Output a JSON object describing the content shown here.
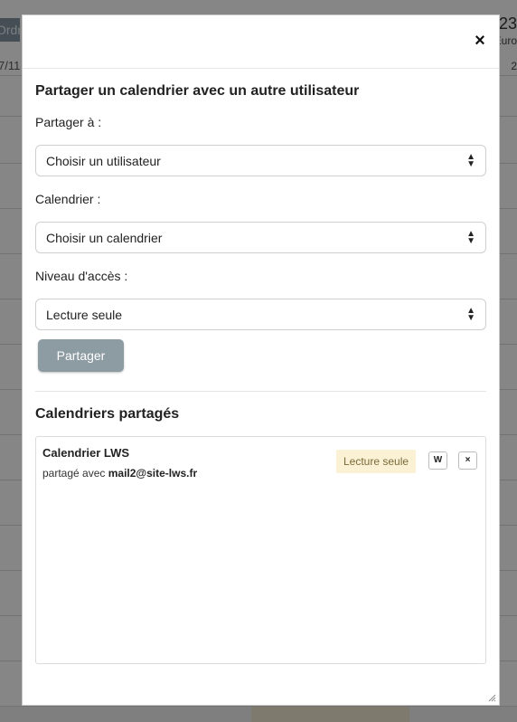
{
  "background": {
    "tab_text": "Ordr",
    "left_date": "7/11",
    "right_top": "23",
    "right_sub": "Euro",
    "right_date": "2"
  },
  "modal": {
    "close_icon": "×",
    "title": "Partager un calendrier avec un autre utilisateur",
    "share_to_label": "Partager à :",
    "share_to_value": "Choisir un utilisateur",
    "calendar_label": "Calendrier :",
    "calendar_value": "Choisir un calendrier",
    "access_label": "Niveau d'accès :",
    "access_value": "Lecture seule",
    "share_button": "Partager",
    "shared_title": "Calendriers partagés",
    "shared": [
      {
        "name": "Calendrier LWS",
        "shared_with_prefix": "partagé avec",
        "shared_with": "mail2@site-lws.fr",
        "access": "Lecture seule",
        "write_button": "W",
        "remove_button": "×"
      }
    ]
  },
  "colors": {
    "share_button_bg": "#8d9ba3",
    "badge_bg": "#fbf1d4"
  }
}
